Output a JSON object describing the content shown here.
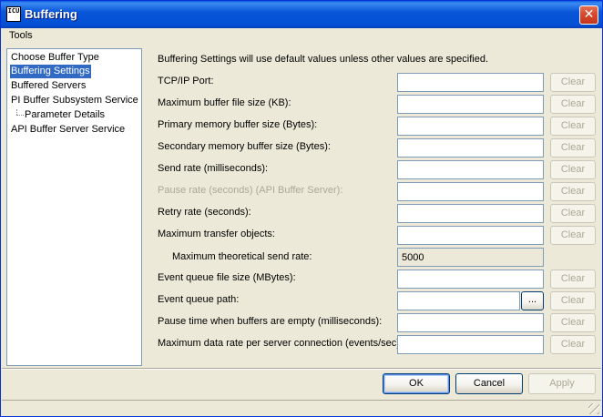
{
  "window": {
    "title": "Buffering",
    "icon": "ICU",
    "close_glyph": "✕"
  },
  "menu": {
    "tools": "Tools"
  },
  "tree": {
    "items": [
      {
        "label": "Choose Buffer Type"
      },
      {
        "label": "Buffering Settings",
        "selected": true
      },
      {
        "label": "Buffered Servers"
      },
      {
        "label": "PI Buffer Subsystem Service"
      },
      {
        "label": "Parameter Details"
      },
      {
        "label": "API Buffer Server Service"
      }
    ]
  },
  "settings": {
    "note": "Buffering Settings will use default values unless other values are specified.",
    "clear_label": "Clear",
    "browse_label": "...",
    "rows": [
      {
        "label": "TCP/IP Port:",
        "value": ""
      },
      {
        "label": "Maximum buffer file size (KB):",
        "value": ""
      },
      {
        "label": "Primary memory buffer size (Bytes):",
        "value": ""
      },
      {
        "label": "Secondary memory buffer size (Bytes):",
        "value": ""
      },
      {
        "label": "Send rate (milliseconds):",
        "value": ""
      },
      {
        "label": "Pause rate (seconds) (API Buffer Server):",
        "value": "",
        "disabled": true
      },
      {
        "label": "Retry rate (seconds):",
        "value": ""
      },
      {
        "label": "Maximum transfer objects:",
        "value": ""
      },
      {
        "label": "Maximum theoretical send rate:",
        "value": "5000",
        "readonly": true
      },
      {
        "label": "Event queue file size (MBytes):",
        "value": ""
      },
      {
        "label": "Event queue path:",
        "value": ""
      },
      {
        "label": "Pause time when buffers are empty (milliseconds):",
        "value": ""
      },
      {
        "label": "Maximum data rate per server connection (events/sec):",
        "value": ""
      }
    ]
  },
  "buttons": {
    "ok": "OK",
    "cancel": "Cancel",
    "apply": "Apply"
  }
}
